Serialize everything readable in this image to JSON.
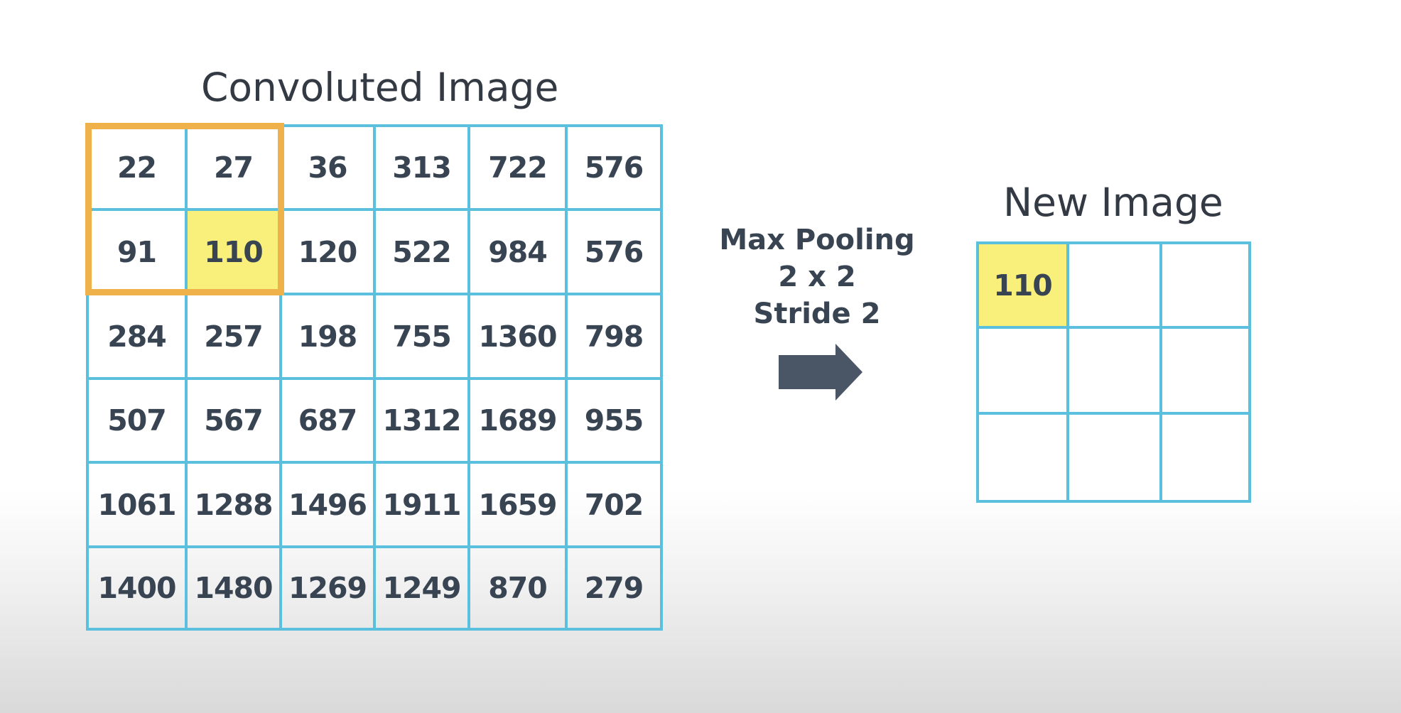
{
  "diagram": {
    "left_title": "Convoluted Image",
    "right_title": "New Image",
    "operation": {
      "line1": "Max Pooling",
      "line2": "2 x 2",
      "line3": "Stride 2"
    },
    "arrow_icon": "right-arrow-icon",
    "colors": {
      "grid_line": "#5bc0de",
      "highlight_fill": "#f8f07a",
      "window_outline": "#efb24b",
      "text": "#394452",
      "arrow": "#4a5565"
    },
    "convoluted_image": {
      "rows": [
        [
          "22",
          "27",
          "36",
          "313",
          "722",
          "576"
        ],
        [
          "91",
          "110",
          "120",
          "522",
          "984",
          "576"
        ],
        [
          "284",
          "257",
          "198",
          "755",
          "1360",
          "798"
        ],
        [
          "507",
          "567",
          "687",
          "1312",
          "1689",
          "955"
        ],
        [
          "1061",
          "1288",
          "1496",
          "1911",
          "1659",
          "702"
        ],
        [
          "1400",
          "1480",
          "1269",
          "1249",
          "870",
          "279"
        ]
      ],
      "highlighted_cell": "row 1, column 1",
      "pooling_window": "rows 0-1, columns 0-1"
    },
    "new_image": {
      "rows": [
        [
          "110",
          "",
          ""
        ],
        [
          "",
          "",
          ""
        ],
        [
          "",
          "",
          ""
        ]
      ],
      "highlighted_cell": "row 0, column 0"
    }
  }
}
